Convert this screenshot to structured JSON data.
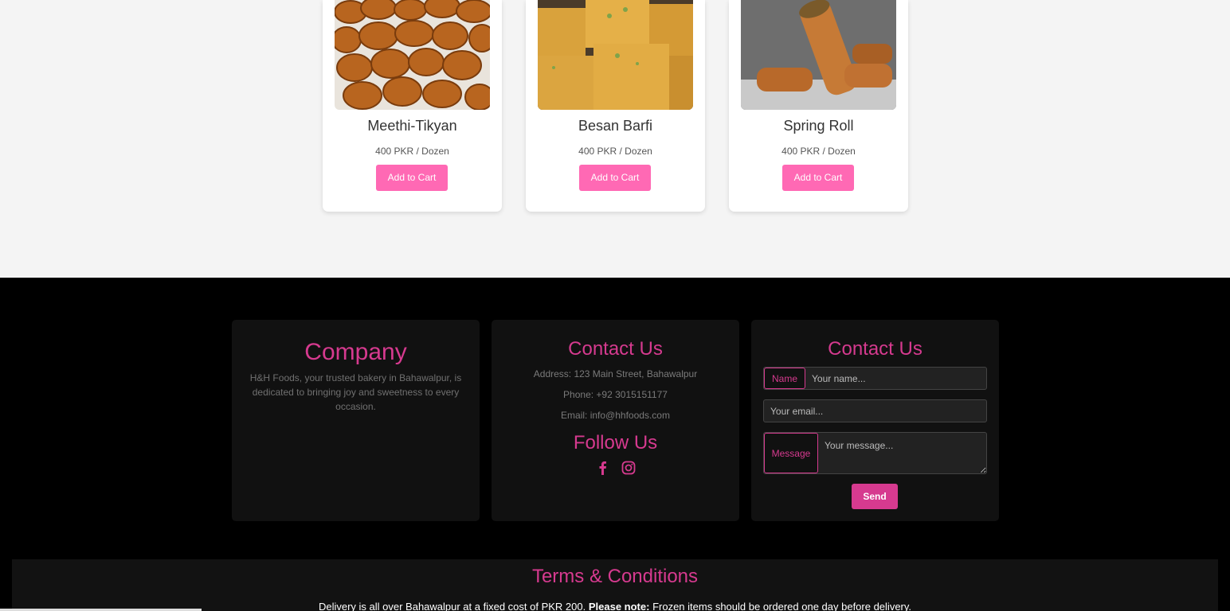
{
  "products": [
    {
      "name": "Meethi-Tikyan",
      "price": "400 PKR / Dozen",
      "button": "Add to Cart",
      "image_icon": "meethi-tikyan-photo"
    },
    {
      "name": "Besan Barfi",
      "price": "400 PKR / Dozen",
      "button": "Add to Cart",
      "image_icon": "besan-barfi-photo"
    },
    {
      "name": "Spring Roll",
      "price": "400 PKR / Dozen",
      "button": "Add to Cart",
      "image_icon": "spring-roll-photo"
    }
  ],
  "footer": {
    "company": {
      "title": "Company",
      "text": "H&H Foods, your trusted bakery in Bahawalpur, is dedicated to bringing joy and sweetness to every occasion."
    },
    "contact": {
      "title": "Contact Us",
      "address": "Address: 123 Main Street, Bahawalpur",
      "phone": "Phone: +92 3015151177",
      "email": "Email: info@hhfoods.com",
      "follow_title": "Follow Us",
      "socials": [
        "facebook-icon",
        "instagram-icon"
      ]
    },
    "form": {
      "title": "Contact Us",
      "name_label": "Name",
      "name_placeholder": "Your name...",
      "email_placeholder": "Your email...",
      "message_label": "Message",
      "message_placeholder": "Your message...",
      "send_label": "Send"
    },
    "terms": {
      "title": "Terms & Conditions",
      "text_part1": "Delivery is all over Bahawalpur at a fixed cost of PKR 200.",
      "bold": "Please note:",
      "text_part2": "Frozen items should be ordered one day before delivery."
    }
  },
  "colors": {
    "accent": "#d63a8f",
    "button_pink": "#ff69b4",
    "footer_bg": "#000000",
    "panel_bg": "#111111"
  }
}
